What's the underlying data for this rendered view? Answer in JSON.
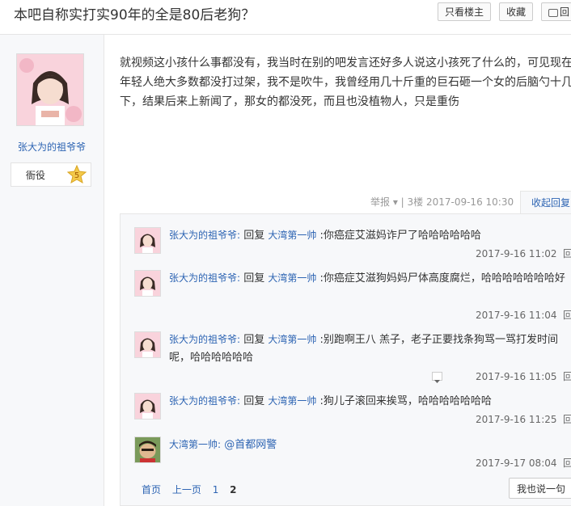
{
  "header": {
    "title": "本吧自称实打实90年的全是80后老狗？",
    "btn_only_op": "只看楼主",
    "btn_favorite": "收藏",
    "btn_reply_glyph": "回"
  },
  "author": {
    "name": "张大为的祖爷爷",
    "rank": "衙役",
    "level": "5"
  },
  "post": {
    "body": "就视频这小孩什么事都没有，我当时在别的吧发言还好多人说这小孩死了什么的，可见现在年轻人绝大多数都没打过架，我不是吹牛，我曾经用几十斤重的巨石砸一个女的后脑勺十几下，结果后来上新闻了，那女的都没死，而且也没植物人，只是重伤",
    "meta": "举报 ▾ | 3楼  2017-09-16 10:30",
    "collapse_label": "收起回复"
  },
  "replies": [
    {
      "user": "张大为的祖爷爷:",
      "verb": "回复",
      "target": "大湾第一帅",
      "text": ":你癌症艾滋妈诈尸了哈哈哈哈哈哈",
      "time": "2017-9-16 11:02",
      "action": "回复"
    },
    {
      "user": "张大为的祖爷爷:",
      "verb": "回复",
      "target": "大湾第一帅",
      "text": ":你癌症艾滋狗妈妈尸体高度腐烂，哈哈哈哈哈哈哈好",
      "time": "2017-9-16 11:04",
      "action": "回复"
    },
    {
      "user": "张大为的祖爷爷:",
      "verb": "回复",
      "target": "大湾第一帅",
      "text": ":别跑啊王八 羔子，老子正要找条狗骂一骂打发时间呢，哈哈哈哈哈哈",
      "time": "2017-9-16 11:05",
      "action": "回复"
    },
    {
      "user": "张大为的祖爷爷:",
      "verb": "回复",
      "target": "大湾第一帅",
      "text": ":狗儿子滚回来挨骂，哈哈哈哈哈哈哈",
      "time": "2017-9-16 11:25",
      "action": "回复"
    },
    {
      "user": "大湾第一帅:",
      "verb": "",
      "target": "",
      "text": "@首都网警",
      "time": "2017-9-17 08:04",
      "action": "回复"
    }
  ],
  "pager": {
    "first": "首页",
    "prev": "上一页",
    "p1": "1",
    "p2": "2"
  },
  "say_button": "我也说一句",
  "colors": {
    "link": "#2d64b3",
    "panel": "#f7f8fa",
    "border": "#e6e6e6"
  }
}
